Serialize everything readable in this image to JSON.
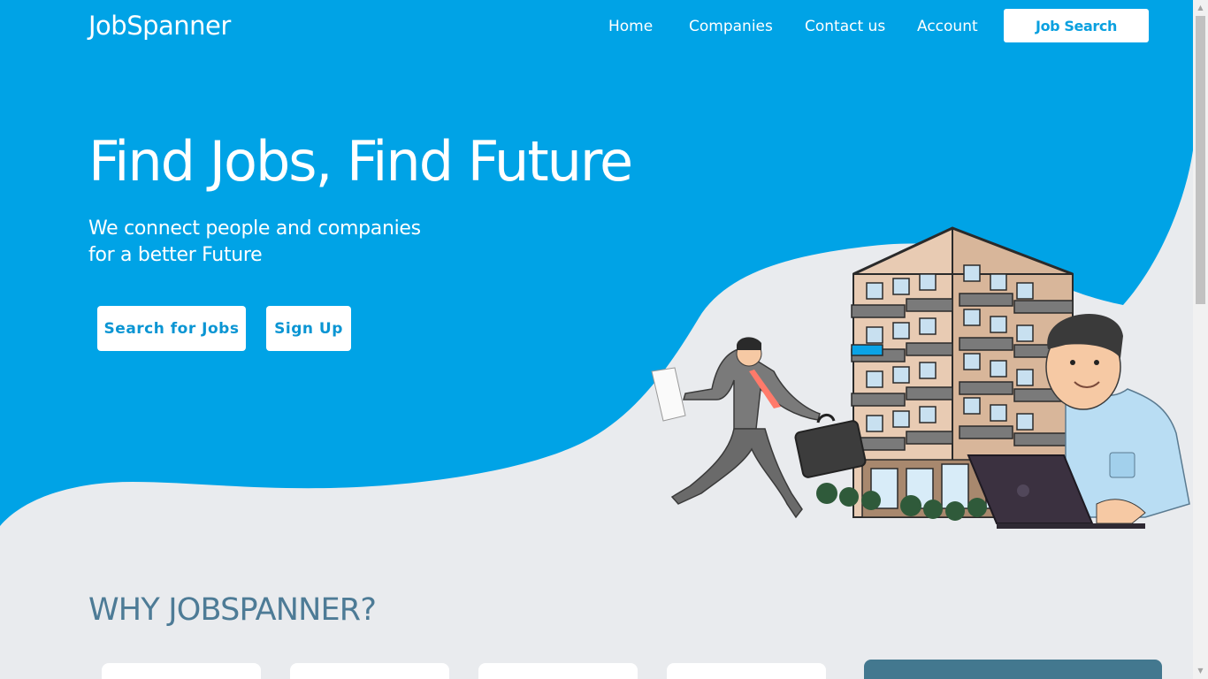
{
  "nav": {
    "logo": "JobSpanner",
    "links": [
      "Home",
      "Companies",
      "Contact us",
      "Account"
    ],
    "cta": "Job Search"
  },
  "hero": {
    "title": "Find Jobs, Find Future",
    "subtitle_line1": "We connect people and companies",
    "subtitle_line2": "for a better Future",
    "btn_search": "Search for Jobs",
    "btn_signup": "Sign Up"
  },
  "section": {
    "title": "WHY JOBSPANNER?"
  },
  "colors": {
    "brand": "#00a3e6",
    "background": "#e9ebee",
    "accent_dark": "#43788f",
    "heading": "#4d7b96"
  }
}
